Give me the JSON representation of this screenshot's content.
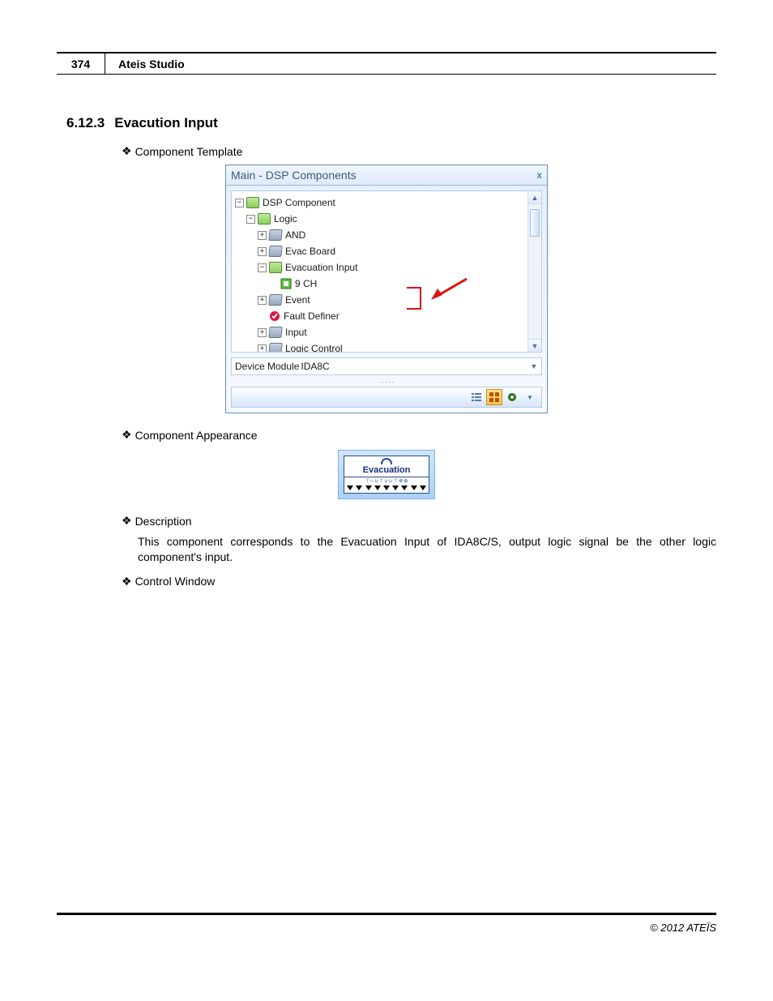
{
  "header": {
    "page_number": "374",
    "doc_title": "Ateis Studio"
  },
  "section": {
    "number": "6.12.3",
    "title": "Evacution Input"
  },
  "bullets": {
    "template": "Component Template",
    "appearance": "Component Appearance",
    "description": "Description",
    "control_window": "Control Window"
  },
  "panel": {
    "title": "Main - DSP Components",
    "tree": {
      "root": "DSP Component",
      "logic": "Logic",
      "items": {
        "and": "AND",
        "evac_board": "Evac Board",
        "evac_input": "Evacuation Input",
        "nine_ch": "9 CH",
        "event": "Event",
        "fault_definer": "Fault Definer",
        "input": "Input",
        "logic_control": "Logic Control"
      }
    },
    "device_label": "Device Module",
    "device_value": "IDA8C"
  },
  "component": {
    "label": "Evacuation",
    "ports": "⊤ ⌐ ∪ ⊤ ∪ ∪ ⊤ ⊗ ⊕"
  },
  "description_text": "This component corresponds to the Evacuation Input of IDA8C/S, output logic signal be the other logic component's input.",
  "footer": "© 2012 ATEÏS"
}
